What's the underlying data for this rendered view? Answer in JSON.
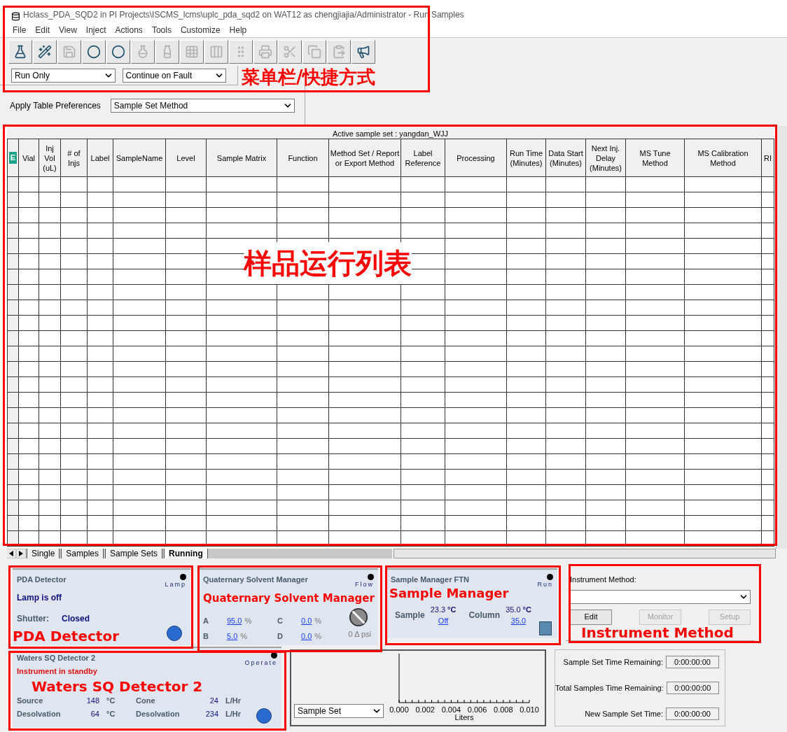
{
  "window": {
    "title": "Hclass_PDA_SQD2 in PI Projects\\ISCMS_lcms\\uplc_pda_sqd2 on WAT12 as chengjiajia/Administrator - Run Samples"
  },
  "menu": [
    "File",
    "Edit",
    "View",
    "Inject",
    "Actions",
    "Tools",
    "Customize",
    "Help"
  ],
  "toolbar": [
    {
      "kind": "vial",
      "disabled": false
    },
    {
      "kind": "wand",
      "disabled": false
    },
    {
      "kind": "save",
      "disabled": true
    },
    {
      "kind": "circle",
      "disabled": false
    },
    {
      "kind": "circle",
      "disabled": false
    },
    {
      "kind": "flask",
      "disabled": true
    },
    {
      "kind": "bottles",
      "disabled": true
    },
    {
      "kind": "tray",
      "disabled": true
    },
    {
      "kind": "columns",
      "disabled": true
    },
    {
      "kind": "bar",
      "disabled": true
    },
    {
      "kind": "printer",
      "disabled": true
    },
    {
      "kind": "scissors",
      "disabled": true
    },
    {
      "kind": "copy",
      "disabled": true
    },
    {
      "kind": "paste",
      "disabled": true
    },
    {
      "kind": "megaphone",
      "disabled": false
    }
  ],
  "run_mode": {
    "value": "Run Only"
  },
  "fault_mode": {
    "value": "Continue on Fault"
  },
  "table_preferences": {
    "label": "Apply Table Preferences",
    "value": "Sample Set Method"
  },
  "table": {
    "caption": "Active sample set : yangdan_WJJ",
    "columns": [
      "E",
      "Vial",
      "Inj Vol (uL)",
      "# of Injs",
      "Label",
      "SampleName",
      "Level",
      "Sample Matrix",
      "Function",
      "Method Set / Report or Export Method",
      "Label Reference",
      "Processing",
      "Run Time (Minutes)",
      "Data Start (Minutes)",
      "Next Inj. Delay (Minutes)",
      "MS Tune Method",
      "MS Calibration Method",
      "RI"
    ]
  },
  "sheet_tabs": [
    {
      "label": "Single",
      "selected": false
    },
    {
      "label": "Samples",
      "selected": false
    },
    {
      "label": "Sample Sets",
      "selected": false
    },
    {
      "label": "Running",
      "selected": true
    }
  ],
  "pda": {
    "title": "PDA Detector",
    "indicator": {
      "label": "Lamp",
      "on": false
    },
    "status": "Lamp is off",
    "shutter_label": "Shutter:",
    "shutter_value": "Closed"
  },
  "qsm": {
    "title": "Quaternary Solvent Manager",
    "indicator": {
      "label": "Flow",
      "on": false
    },
    "rows": [
      [
        {
          "label": "A",
          "value": "95.0",
          "unit": "%"
        },
        {
          "label": "C",
          "value": "0.0",
          "unit": "%"
        }
      ],
      [
        {
          "label": "B",
          "value": "5.0",
          "unit": "%"
        },
        {
          "label": "D",
          "value": "0.0",
          "unit": "%"
        }
      ]
    ],
    "delta": "0 Δ psi"
  },
  "sample_manager": {
    "title": "Sample Manager FTN",
    "indicator": {
      "label": "Run",
      "on": false
    },
    "sample_label": "Sample",
    "sample_temp": "23.3",
    "sample_unit": "°C",
    "sample_set": "Off",
    "column_label": "Column",
    "column_temp": "35.0",
    "column_unit": "°C",
    "column_set": "35.0"
  },
  "instrument_method": {
    "label": "Instrument Method:",
    "buttons": [
      {
        "label": "Edit",
        "disabled": false
      },
      {
        "label": "Monitor",
        "disabled": true
      },
      {
        "label": "Setup",
        "disabled": true
      }
    ]
  },
  "sq_detector": {
    "title": "Waters SQ Detector 2",
    "indicator": {
      "label": "Operate",
      "on": false
    },
    "status": "Instrument in standby",
    "rows": [
      [
        {
          "label": "Source",
          "value": "148",
          "unit": "°C"
        },
        {
          "label": "Cone",
          "value": "24",
          "unit": "L/Hr"
        }
      ],
      [
        {
          "label": "Desolvation",
          "value": "64",
          "unit": "°C"
        },
        {
          "label": "Desolvation",
          "value": "234",
          "unit": "L/Hr"
        }
      ]
    ]
  },
  "progress": {
    "selector": "Sample Set",
    "axis_labels": [
      "0.000",
      "0.002",
      "0.004",
      "0.006",
      "0.008",
      "0.010"
    ],
    "axis_title": "Liters"
  },
  "times": [
    {
      "label": "Sample Set Time Remaining:",
      "value": "0:00:00:00"
    },
    {
      "label": "Total Samples Time Remaining:",
      "value": "0:00:00:00"
    },
    {
      "label": "New Sample Set Time:",
      "value": "0:00:00:00"
    }
  ],
  "annotations": [
    {
      "text": "菜单栏/快捷方式"
    },
    {
      "text": "样品运行列表"
    },
    {
      "text": "PDA Detector"
    },
    {
      "text": "Quaternary Solvent Manager"
    },
    {
      "text": "Sample Manager"
    },
    {
      "text": "Instrument Method"
    },
    {
      "text": "Waters SQ Detector 2"
    }
  ]
}
